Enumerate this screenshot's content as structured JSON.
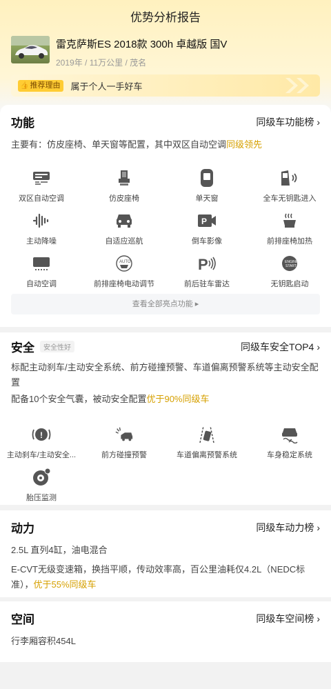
{
  "header": {
    "title": "优势分析报告",
    "car_name": "雷克萨斯ES 2018款 300h 卓越版 国V",
    "car_sub": "2019年 / 11万公里 / 茂名",
    "reason_tag": "推荐理由",
    "reason_text": "属于个人一手好车"
  },
  "features": {
    "title": "功能",
    "link": "同级车功能榜",
    "summary_prefix": "主要有：仿皮座椅、单天窗等配置，其中双区自动空调",
    "summary_highlight": "同级领先",
    "items": [
      {
        "label": "双区自动空调",
        "icon": "dual-zone-ac-icon"
      },
      {
        "label": "仿皮座椅",
        "icon": "seat-icon"
      },
      {
        "label": "单天窗",
        "icon": "sunroof-icon"
      },
      {
        "label": "全车无钥匙进入",
        "icon": "keyless-entry-icon"
      },
      {
        "label": "主动降噪",
        "icon": "noise-cancel-icon"
      },
      {
        "label": "自适应巡航",
        "icon": "adaptive-cruise-icon"
      },
      {
        "label": "倒车影像",
        "icon": "reverse-camera-icon"
      },
      {
        "label": "前排座椅加热",
        "icon": "seat-heating-icon"
      },
      {
        "label": "自动空调",
        "icon": "auto-ac-icon"
      },
      {
        "label": "前排座椅电动调节",
        "icon": "power-seat-icon"
      },
      {
        "label": "前后驻车雷达",
        "icon": "parking-radar-icon"
      },
      {
        "label": "无钥匙启动",
        "icon": "keyless-start-icon"
      }
    ],
    "more": "查看全部亮点功能 ▸"
  },
  "safety": {
    "title": "安全",
    "pill": "安全性好",
    "link": "同级车安全TOP4",
    "text1": "标配主动刹车/主动安全系统、前方碰撞预警、车道偏离预警系统等主动安全配置",
    "text2_prefix": "配备10个安全气囊，被动安全配置",
    "text2_highlight": "优于90%同级车",
    "items": [
      {
        "label": "主动刹车/主动安全...",
        "icon": "active-brake-icon"
      },
      {
        "label": "前方碰撞预警",
        "icon": "collision-warning-icon"
      },
      {
        "label": "车道偏离预警系统",
        "icon": "lane-departure-icon"
      },
      {
        "label": "车身稳定系统",
        "icon": "stability-icon"
      },
      {
        "label": "胎压监测",
        "icon": "tire-pressure-icon"
      }
    ]
  },
  "power": {
    "title": "动力",
    "link": "同级车动力榜",
    "text1": "2.5L 直列4缸，油电混合",
    "text2_prefix": "E-CVT无级变速箱，换挡平顺，传动效率高，百公里油耗仅4.2L（NEDC标准），",
    "text2_highlight": "优于55%同级车"
  },
  "space": {
    "title": "空间",
    "link": "同级车空间榜",
    "text1": "行李厢容积454L"
  },
  "colors": {
    "accent": "#d6a000",
    "tag": "#ffcc33"
  }
}
